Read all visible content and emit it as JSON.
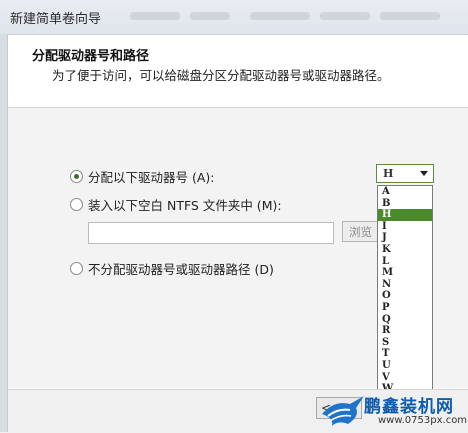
{
  "window": {
    "title": "新建简单卷向导"
  },
  "header": {
    "title": "分配驱动器号和路径",
    "subtitle": "为了便于访问，可以给磁盘分区分配驱动器号或驱动器路径。"
  },
  "options": {
    "assign_letter": {
      "label": "分配以下驱动器号 (A):",
      "selected": true
    },
    "mount_folder": {
      "label": "装入以下空白 NTFS 文件夹中 (M):",
      "selected": false
    },
    "no_assign": {
      "label": "不分配驱动器号或驱动器路径 (D)",
      "selected": false
    }
  },
  "folder_path": {
    "value": ""
  },
  "browse_button": {
    "label": "浏览"
  },
  "drive_select": {
    "value": "H",
    "options": [
      "A",
      "B",
      "H",
      "I",
      "J",
      "K",
      "L",
      "M",
      "N",
      "O",
      "P",
      "Q",
      "R",
      "S",
      "T",
      "U",
      "V",
      "W",
      "X",
      "Y",
      "Z"
    ],
    "highlighted": "H"
  },
  "footer": {
    "back_label": "<"
  },
  "watermark": {
    "name": "鹏鑫装机网",
    "url": "www.0753px.com"
  },
  "colors": {
    "accent_green": "#4a8a2a",
    "watermark_blue": "#0e5cad"
  }
}
